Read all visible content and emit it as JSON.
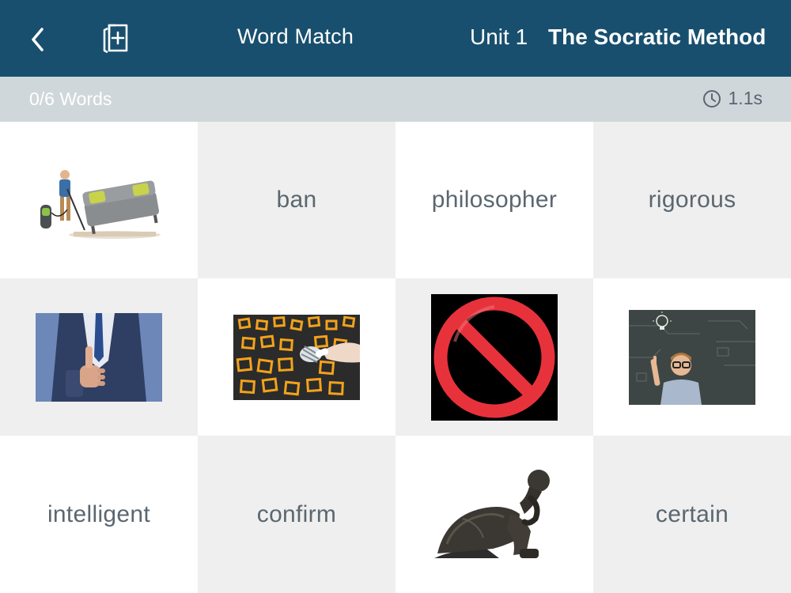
{
  "header": {
    "mode_title": "Word Match",
    "unit_label": "Unit 1",
    "lesson_title": "The Socratic Method",
    "back_icon": "chevron-left-icon",
    "add_icon": "add-card-icon",
    "background_color": "#184f6e"
  },
  "status": {
    "progress": "0/6 Words",
    "timer": "1.1s",
    "timer_icon": "clock-icon"
  },
  "cards": [
    {
      "kind": "image",
      "image": "man vacuuming under lifted sofa"
    },
    {
      "kind": "word",
      "text": "ban"
    },
    {
      "kind": "word",
      "text": "philosopher"
    },
    {
      "kind": "word",
      "text": "rigorous"
    },
    {
      "kind": "image",
      "image": "businessman giving thumbs up"
    },
    {
      "kind": "image",
      "image": "chalk squares with one crossed out"
    },
    {
      "kind": "image",
      "image": "red prohibition sign"
    },
    {
      "kind": "image",
      "image": "boy with glasses and lightbulb idea"
    },
    {
      "kind": "word",
      "text": "intelligent"
    },
    {
      "kind": "word",
      "text": "confirm"
    },
    {
      "kind": "image",
      "image": "thinker statue"
    },
    {
      "kind": "word",
      "text": "certain"
    }
  ]
}
